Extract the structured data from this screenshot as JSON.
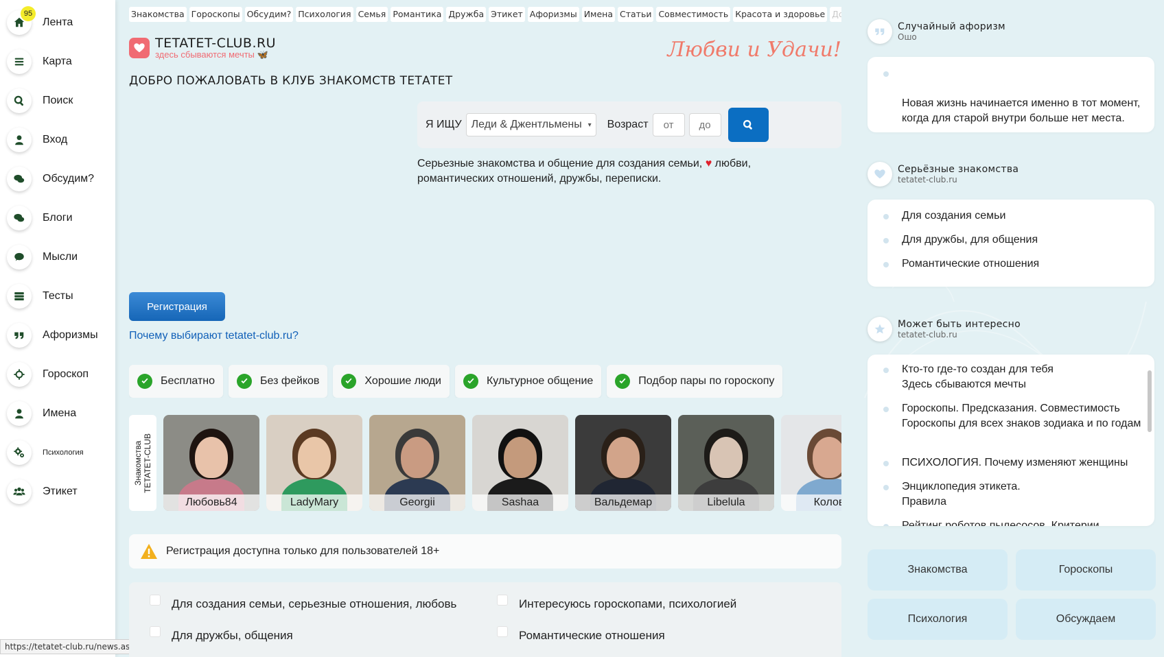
{
  "sidebar": {
    "badge": "95",
    "items": [
      {
        "label": "Лента"
      },
      {
        "label": "Карта"
      },
      {
        "label": "Поиск"
      },
      {
        "label": "Вход"
      },
      {
        "label": "Обсудим?"
      },
      {
        "label": "Блоги"
      },
      {
        "label": "Мысли"
      },
      {
        "label": "Тесты"
      },
      {
        "label": "Афоризмы"
      },
      {
        "label": "Гороскоп"
      },
      {
        "label": "Имена"
      },
      {
        "label": "Психология"
      },
      {
        "label": "Этикет"
      }
    ]
  },
  "status_url": "https://tetatet-club.ru/news.asp",
  "topnav": [
    "Знакомства",
    "Гороскопы",
    "Обсудим?",
    "Психология",
    "Семья",
    "Романтика",
    "Дружба",
    "Этикет",
    "Афоризмы",
    "Имена",
    "Статьи",
    "Совместимость",
    "Красота и здоровье",
    "Досу"
  ],
  "brand": {
    "name": "TETATET-CLUB.RU",
    "tagline": "здесь сбываются мечты"
  },
  "slogan": "Любви и Удачи!",
  "welcome": "ДОБРО ПОЖАЛОВАТЬ В КЛУБ ЗНАКОМСТВ ТЕТАТЕТ",
  "search": {
    "label": "Я ИЩУ",
    "select_value": "Леди & Джентльмены",
    "age_label": "Возраст",
    "from_placeholder": "от",
    "to_placeholder": "до"
  },
  "description": {
    "part1": "Серьезные знакомства и общение для создания семьи,",
    "heart": "♥",
    "part2": " любви, романтических отношений, дружбы, переписки."
  },
  "register_button": "Регистрация",
  "why_link": "Почему выбирают tetatet-club.ru?",
  "features": [
    "Бесплатно",
    "Без фейков",
    "Хорошие люди",
    "Культурное общение",
    "Подбор пары по гороскопу"
  ],
  "profiles": {
    "label": "Знакомства\nTETATET-CLUB",
    "items": [
      {
        "name": "Любовь84",
        "bg": "#8c8c86",
        "skin": "#e8c2aa",
        "hair": "#1e1410",
        "cloth": "#c77a8a"
      },
      {
        "name": "LadyMary",
        "bg": "#d9cfc3",
        "skin": "#e9c6a8",
        "hair": "#5b3a22",
        "cloth": "#2e9a5e"
      },
      {
        "name": "Georgii",
        "bg": "#b7a78f",
        "skin": "#c99b82",
        "hair": "#3a3a3a",
        "cloth": "#2c3a52"
      },
      {
        "name": "Sashaa",
        "bg": "#d8d6d2",
        "skin": "#c49a7c",
        "hair": "#111111",
        "cloth": "#1b1b1b"
      },
      {
        "name": "Вальдемар",
        "bg": "#3b3b3b",
        "skin": "#d2a48a",
        "hair": "#2a2018",
        "cloth": "#202633"
      },
      {
        "name": "Libelula",
        "bg": "#5b5f58",
        "skin": "#d8c4b4",
        "hair": "#1d1b18",
        "cloth": "#3d3d3d"
      },
      {
        "name": "Колов",
        "bg": "#e4e6e8",
        "skin": "#d8a890",
        "hair": "#6a4a36",
        "cloth": "#7fa9cf"
      }
    ]
  },
  "warning": "Регистрация доступна только для пользователей 18+",
  "interests": [
    "Для создания семьи, серьезные отношения, любовь",
    "Интересуюсь гороскопами, психологией",
    "Для дружбы, общения",
    "Романтические отношения"
  ],
  "right": {
    "aphorism": {
      "title": "Случайный афоризм",
      "author": "Ошо",
      "text": "Новая жизнь начинается именно в тот момент,\nкогда для старой внутри больше нет места."
    },
    "serious": {
      "title": "Серьёзные знакомства",
      "sub": "tetatet-club.ru",
      "items": [
        "Для создания семьи",
        "Для дружбы, для общения",
        "Романтические отношения"
      ]
    },
    "interesting": {
      "title": "Может быть интересно",
      "sub": "tetatet-club.ru",
      "items": [
        "Кто-то где-то создан для тебя\nЗдесь сбываются мечты",
        "Гороскопы. Предсказания. Совместимость\nГороскопы для всех знаков зодиака и по годам",
        "ПСИХОЛОГИЯ. Почему изменяют женщины",
        "Энциклопедия этикета.\nПравила",
        "Рейтинг роботов пылесосов. Критерии"
      ]
    },
    "tiles": [
      "Знакомства",
      "Гороскопы",
      "Психология",
      "Обсуждаем"
    ]
  },
  "colors": {
    "accent": "#0b6ec2",
    "brand_pink": "#f06b73",
    "check_green": "#2aa42a",
    "page_bg": "#e3f1f4",
    "tile_bg": "#d5ecf5"
  }
}
